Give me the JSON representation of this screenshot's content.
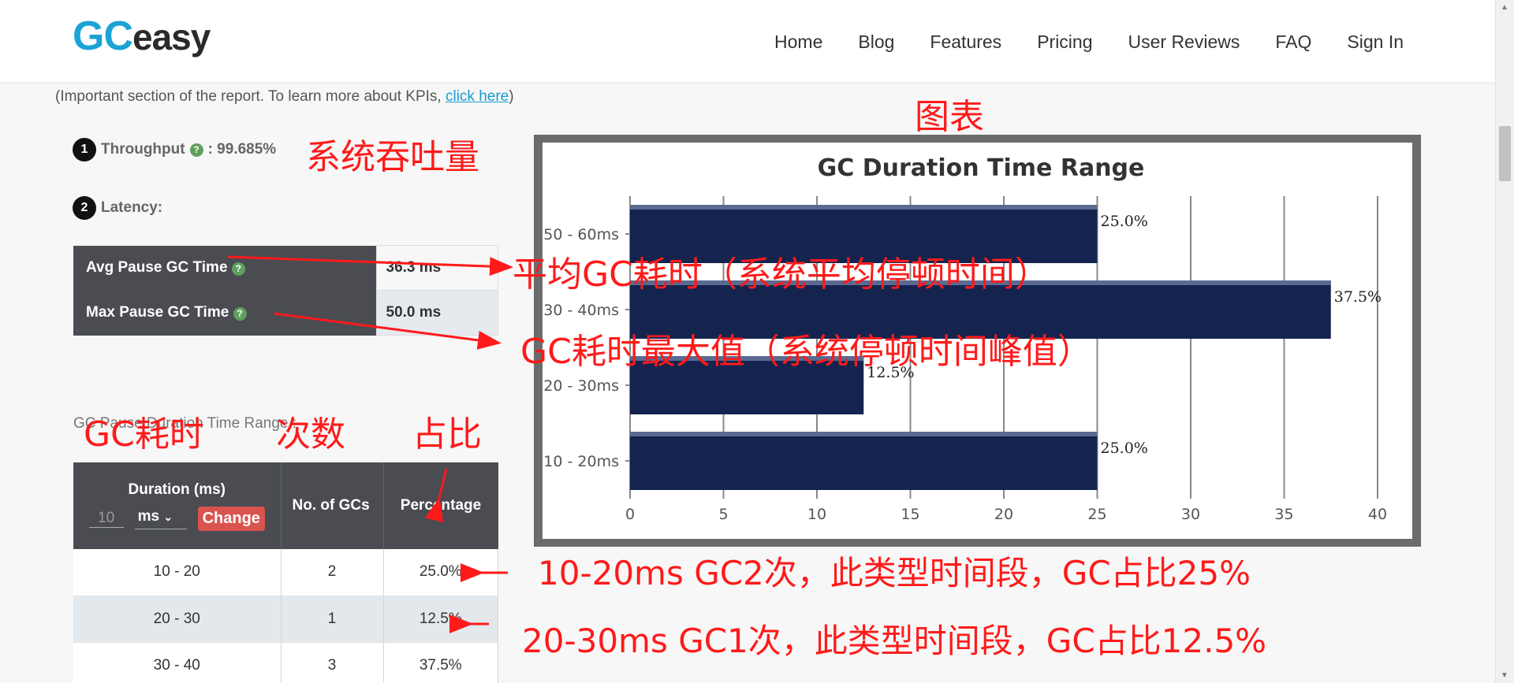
{
  "header": {
    "logo_gc": "GC",
    "logo_easy": "easy",
    "nav": [
      "Home",
      "Blog",
      "Features",
      "Pricing",
      "User Reviews",
      "FAQ",
      "Sign In"
    ]
  },
  "intro": {
    "prefix": "(Important section of the report. To learn more about KPIs, ",
    "link": "click here",
    "suffix": ")"
  },
  "kpis": {
    "throughput_num": "1",
    "throughput_label": "Throughput",
    "throughput_value": ": 99.685%",
    "latency_num": "2",
    "latency_label": "Latency:"
  },
  "latency_table": [
    {
      "label": "Avg Pause GC Time",
      "value": "36.3 ms"
    },
    {
      "label": "Max Pause GC Time",
      "value": "50.0 ms"
    }
  ],
  "range_section_title": "GC Pause Duration Time Range :",
  "range_table": {
    "headers": {
      "duration": "Duration (ms)",
      "count": "No. of GCs",
      "percentage": "Percentage"
    },
    "duration_input": "10",
    "unit_select": "ms",
    "change_button": "Change",
    "rows": [
      {
        "range": "10 - 20",
        "count": "2",
        "pct": "25.0%"
      },
      {
        "range": "20 - 30",
        "count": "1",
        "pct": "12.5%"
      },
      {
        "range": "30 - 40",
        "count": "3",
        "pct": "37.5%"
      }
    ]
  },
  "chart_data": {
    "type": "bar",
    "orientation": "horizontal",
    "title": "GC Duration Time Range",
    "categories": [
      "50 - 60ms",
      "30 - 40ms",
      "20 - 30ms",
      "10 - 20ms"
    ],
    "values": [
      25.0,
      37.5,
      12.5,
      25.0
    ],
    "data_labels": [
      "25.0%",
      "37.5%",
      "12.5%",
      "25.0%"
    ],
    "xlim": [
      0,
      40
    ],
    "xticks": [
      0,
      5,
      10,
      15,
      20,
      25,
      30,
      35,
      40
    ],
    "grid": true,
    "bar_color": "#14244f"
  },
  "annotations": {
    "chart": "图表",
    "throughput": "系统吞吐量",
    "avg": "平均GC耗时（系统平均停顿时间）",
    "max": "GC耗时最大值（系统停顿时间峰值）",
    "col_duration": "GC耗时",
    "col_count": "次数",
    "col_pct": "占比",
    "row1": "10-20ms GC2次，此类型时间段，GC占比25%",
    "row2": "20-30ms GC1次，此类型时间段，GC占比12.5%"
  },
  "colors": {
    "annotation": "#ff1a1a",
    "logo_accent": "#1aa3d4",
    "change_button": "#d9534f"
  }
}
